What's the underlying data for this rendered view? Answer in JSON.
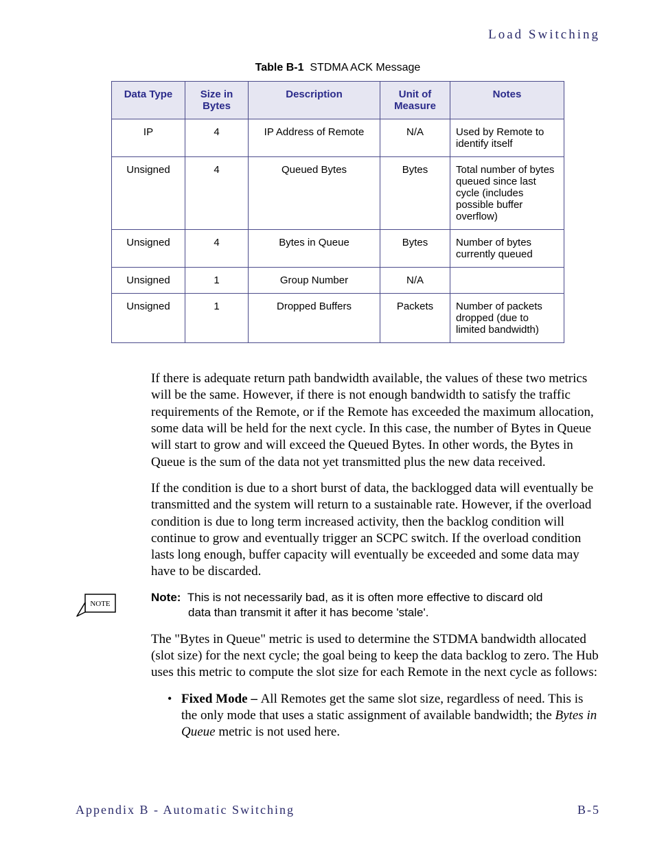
{
  "header": {
    "section": "Load Switching"
  },
  "table": {
    "caption_label": "Table B-1",
    "caption_title": "STDMA ACK Message",
    "columns": [
      "Data Type",
      "Size in Bytes",
      "Description",
      "Unit of Measure",
      "Notes"
    ],
    "rows": [
      {
        "type": "IP",
        "size": "4",
        "desc": "IP Address of Remote",
        "unit": "N/A",
        "notes": "Used by Remote to identify itself"
      },
      {
        "type": "Unsigned",
        "size": "4",
        "desc": "Queued Bytes",
        "unit": "Bytes",
        "notes": "Total number of bytes queued since last cycle (includes possible buffer overflow)"
      },
      {
        "type": "Unsigned",
        "size": "4",
        "desc": "Bytes in Queue",
        "unit": "Bytes",
        "notes": "Number of bytes currently queued"
      },
      {
        "type": "Unsigned",
        "size": "1",
        "desc": "Group Number",
        "unit": "N/A",
        "notes": ""
      },
      {
        "type": "Unsigned",
        "size": "1",
        "desc": "Dropped Buffers",
        "unit": "Packets",
        "notes": "Number of packets dropped (due to limited bandwidth)"
      }
    ]
  },
  "paragraphs": {
    "p1": "If there is adequate return path bandwidth available, the values of these two metrics will be the same. However, if there is not enough bandwidth to satisfy the traffic requirements of the Remote, or if the Remote has exceeded the maximum allocation, some data will be held for the next cycle. In this case, the number of Bytes in Queue will start to grow and will exceed the Queued Bytes. In other words, the Bytes in Queue is the sum of the data not yet transmitted plus the new data received.",
    "p2": "If the condition is due to a short burst of data, the backlogged data will eventually be transmitted and the system will return to a sustainable rate. However, if the overload condition is due to long term increased activity, then the backlog condition will continue to grow and eventually trigger an SCPC switch. If the overload condition lasts long enough, buffer capacity will eventually be exceeded and some data may have to be discarded.",
    "note_label": "Note:",
    "note_line1": "This is not necessarily bad, as it is often more effective to discard old",
    "note_line2": "data than transmit it after it has become 'stale'.",
    "p3": "The \"Bytes in Queue\" metric is used to determine the STDMA bandwidth allocated (slot size) for the next cycle; the goal being to keep the data backlog to zero. The Hub uses this metric to compute the slot size for each Remote in the next cycle as follows:",
    "bullet_lead": "Fixed Mode – ",
    "bullet_body1": "All Remotes get the same slot size, regardless of need. This is the only mode that uses a static assignment of available bandwidth; the ",
    "bullet_italic": "Bytes in Queue",
    "bullet_body2": " metric is not used here."
  },
  "note_icon": {
    "label": "NOTE"
  },
  "footer": {
    "left": "Appendix B - Automatic Switching",
    "right": "B-5"
  }
}
